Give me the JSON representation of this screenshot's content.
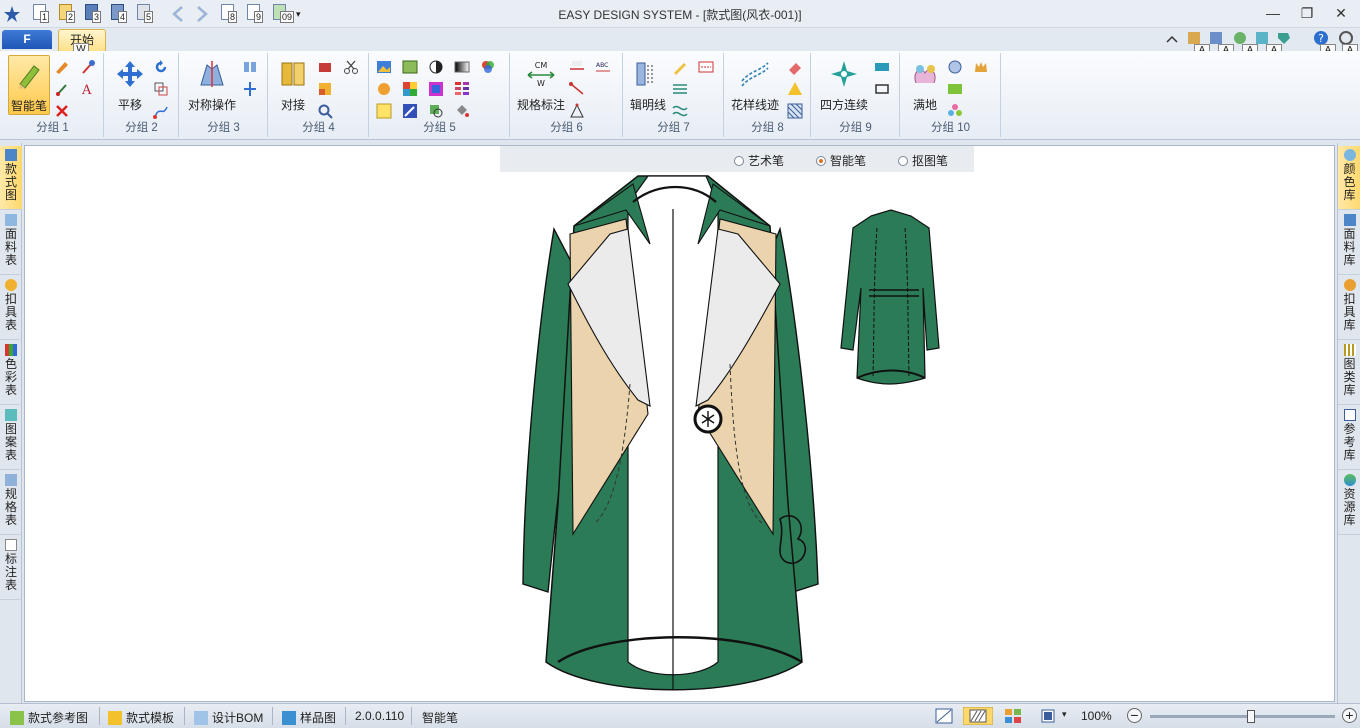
{
  "titlebar": {
    "title": "EASY DESIGN SYSTEM - [款式图(风衣-001)]",
    "quick_access": [
      "1",
      "2",
      "3",
      "4",
      "5",
      "8",
      "9",
      "09"
    ],
    "minimize": "—",
    "restore": "❐",
    "close": "✕"
  },
  "tabs": {
    "file": "F",
    "home": "开始",
    "home_keytip": "W"
  },
  "keytips_right": [
    "A",
    "A",
    "A",
    "A",
    "A",
    "A"
  ],
  "ribbon": {
    "groups": [
      {
        "label": "分组 1",
        "big": "智能笔"
      },
      {
        "label": "分组 2",
        "big": "平移"
      },
      {
        "label": "分组 3",
        "big": "对称操作"
      },
      {
        "label": "分组 4",
        "big": "对接"
      },
      {
        "label": "分组 5"
      },
      {
        "label": "分组 6",
        "big": "规格标注",
        "big_icon_text_top": "CM",
        "big_icon_text_bottom": "W"
      },
      {
        "label": "分组 7",
        "big": "辑明线"
      },
      {
        "label": "分组 8",
        "big": "花样线迹"
      },
      {
        "label": "分组 9",
        "big": "四方连续"
      },
      {
        "label": "分组 10",
        "big": "满地"
      }
    ]
  },
  "left_tabs": [
    "款式图",
    "面料表",
    "扣具表",
    "色彩表",
    "图案表",
    "规格表",
    "标注表"
  ],
  "right_tabs": [
    "颜色库",
    "面料库",
    "扣具库",
    "图类库",
    "参考库",
    "资源库"
  ],
  "pen_bar": {
    "options": [
      "艺术笔",
      "智能笔",
      "抠图笔"
    ],
    "selected": "智能笔"
  },
  "statusbar": {
    "items": [
      "款式参考图",
      "款式模板",
      "设计BOM",
      "样品图"
    ],
    "version": "2.0.0.110",
    "mode": "智能笔",
    "zoom": "100%",
    "zoom_out": "−",
    "zoom_in": "+",
    "zoom_level": 0.55
  },
  "colors": {
    "coat_green": "#2b7b57",
    "coat_dark": "#1f5f42",
    "lining_beige": "#ead3ad",
    "collar_white": "#ebebeb",
    "accent_orange": "#ffd86b",
    "ribbon_blue": "#1f56b8"
  }
}
